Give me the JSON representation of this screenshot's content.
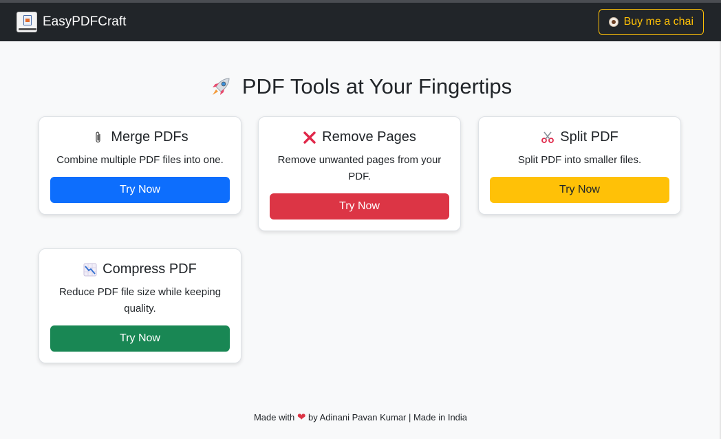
{
  "navbar": {
    "brand_name": "EasyPDFCraft",
    "chai_button_label": "Buy me a chai",
    "accent_color": "#ffc107"
  },
  "page_title": "PDF Tools at Your Fingertips",
  "tools": [
    {
      "title": "Merge PDFs",
      "icon": "paperclip-icon",
      "description": "Combine multiple PDF files into one.",
      "button_label": "Try Now",
      "button_color": "#0d6efd"
    },
    {
      "title": "Remove Pages",
      "icon": "cross-mark-icon",
      "description": "Remove unwanted pages from your PDF.",
      "button_label": "Try Now",
      "button_color": "#dc3545"
    },
    {
      "title": "Split PDF",
      "icon": "scissors-icon",
      "description": "Split PDF into smaller files.",
      "button_label": "Try Now",
      "button_color": "#ffc107"
    },
    {
      "title": "Compress PDF",
      "icon": "chart-decreasing-icon",
      "description": "Reduce PDF file size while keeping quality.",
      "button_label": "Try Now",
      "button_color": "#198754"
    }
  ],
  "footer": {
    "made_with": "Made with",
    "byline": "by Adinani Pavan Kumar | Made in India"
  }
}
